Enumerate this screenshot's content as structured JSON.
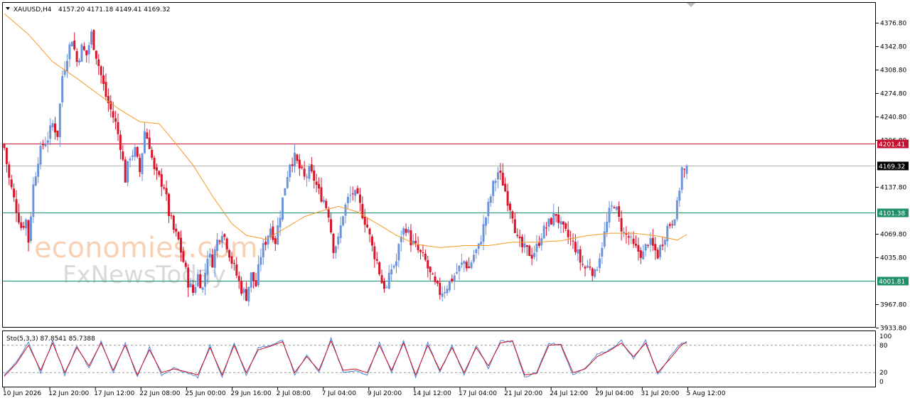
{
  "header": {
    "symbol": "XAUUSD,H4",
    "ohlc": "4157.20 4171.18 4149.41 4169.32"
  },
  "watermark": {
    "line1": "economies.com",
    "line2": "FxNewsToday"
  },
  "colors": {
    "bull": "#6c94dc",
    "bear": "#d9142b",
    "ma": "#f59a23",
    "resistance": "#c8102e",
    "support": "#1f8f6a",
    "current": "#b5b5b5",
    "stoch_k": "#4f86d6",
    "stoch_d": "#d0101e"
  },
  "chart_data": [
    {
      "type": "candlestick",
      "symbol": "XAUUSD",
      "timeframe": "H4",
      "y_ticks": [
        "4376.80",
        "4342.80",
        "4308.80",
        "4274.80",
        "4240.80",
        "4206.80",
        "4137.80",
        "4069.80",
        "4035.80",
        "3967.80",
        "3933.80"
      ],
      "ylim": [
        3933.8,
        4393.0
      ],
      "x_ticks": [
        "10 Jun 2026",
        "12 Jun 20:00",
        "17 Jun 12:00",
        "22 Jun 08:00",
        "25 Jun 00:00",
        "29 Jun 16:00",
        "2 Jul 08:00",
        "7 Jul 04:00",
        "9 Jul 20:00",
        "14 Jul 12:00",
        "17 Jul 04:00",
        "21 Jul 20:00",
        "24 Jul 12:00",
        "29 Jul 04:00",
        "31 Jul 20:00",
        "5 Aug 12:00"
      ],
      "levels": [
        {
          "label": "4201.41",
          "value": 4201.41,
          "kind": "resistance"
        },
        {
          "label": "4169.32",
          "value": 4169.32,
          "kind": "current"
        },
        {
          "label": "4101.38",
          "value": 4101.38,
          "kind": "support"
        },
        {
          "label": "4001.81",
          "value": 4001.81,
          "kind": "support"
        }
      ],
      "close_anchors": [
        [
          0,
          4195
        ],
        [
          2,
          4150
        ],
        [
          4,
          4120
        ],
        [
          7,
          4080
        ],
        [
          9,
          4090
        ],
        [
          10,
          4060
        ],
        [
          12,
          4140
        ],
        [
          14,
          4180
        ],
        [
          16,
          4200
        ],
        [
          18,
          4210
        ],
        [
          20,
          4230
        ],
        [
          22,
          4215
        ],
        [
          24,
          4300
        ],
        [
          26,
          4330
        ],
        [
          28,
          4355
        ],
        [
          30,
          4320
        ],
        [
          32,
          4340
        ],
        [
          34,
          4330
        ],
        [
          36,
          4360
        ],
        [
          38,
          4330
        ],
        [
          40,
          4300
        ],
        [
          42,
          4270
        ],
        [
          44,
          4250
        ],
        [
          46,
          4230
        ],
        [
          48,
          4200
        ],
        [
          50,
          4150
        ],
        [
          52,
          4185
        ],
        [
          54,
          4190
        ],
        [
          56,
          4160
        ],
        [
          58,
          4220
        ],
        [
          60,
          4200
        ],
        [
          62,
          4160
        ],
        [
          64,
          4150
        ],
        [
          66,
          4140
        ],
        [
          68,
          4100
        ],
        [
          70,
          4075
        ],
        [
          72,
          4060
        ],
        [
          74,
          4030
        ],
        [
          76,
          4000
        ],
        [
          78,
          3985
        ],
        [
          80,
          4010
        ],
        [
          82,
          3990
        ],
        [
          84,
          4040
        ],
        [
          86,
          4030
        ],
        [
          88,
          4060
        ],
        [
          90,
          4075
        ],
        [
          92,
          4055
        ],
        [
          94,
          4030
        ],
        [
          96,
          4010
        ],
        [
          98,
          3990
        ],
        [
          100,
          3980
        ],
        [
          102,
          4010
        ],
        [
          104,
          3995
        ],
        [
          106,
          4040
        ],
        [
          108,
          4060
        ],
        [
          110,
          4080
        ],
        [
          112,
          4060
        ],
        [
          114,
          4100
        ],
        [
          116,
          4140
        ],
        [
          118,
          4175
        ],
        [
          120,
          4180
        ],
        [
          122,
          4165
        ],
        [
          124,
          4150
        ],
        [
          126,
          4160
        ],
        [
          128,
          4150
        ],
        [
          130,
          4130
        ],
        [
          132,
          4120
        ],
        [
          134,
          4100
        ],
        [
          136,
          4050
        ],
        [
          138,
          4060
        ],
        [
          140,
          4100
        ],
        [
          142,
          4120
        ],
        [
          144,
          4130
        ],
        [
          146,
          4120
        ],
        [
          148,
          4100
        ],
        [
          150,
          4080
        ],
        [
          152,
          4050
        ],
        [
          154,
          4030
        ],
        [
          156,
          4000
        ],
        [
          158,
          3990
        ],
        [
          160,
          4020
        ],
        [
          162,
          4030
        ],
        [
          164,
          4070
        ],
        [
          166,
          4080
        ],
        [
          168,
          4060
        ],
        [
          170,
          4050
        ],
        [
          172,
          4040
        ],
        [
          174,
          4030
        ],
        [
          176,
          4010
        ],
        [
          178,
          3995
        ],
        [
          180,
          3985
        ],
        [
          182,
          3990
        ],
        [
          184,
          4000
        ],
        [
          186,
          4010
        ],
        [
          188,
          4020
        ],
        [
          190,
          4030
        ],
        [
          192,
          4020
        ],
        [
          194,
          4040
        ],
        [
          196,
          4050
        ],
        [
          198,
          4080
        ],
        [
          200,
          4110
        ],
        [
          202,
          4140
        ],
        [
          204,
          4160
        ],
        [
          206,
          4145
        ],
        [
          208,
          4120
        ],
        [
          210,
          4100
        ],
        [
          212,
          4060
        ],
        [
          214,
          4050
        ],
        [
          216,
          4045
        ],
        [
          218,
          4040
        ],
        [
          220,
          4050
        ],
        [
          222,
          4070
        ],
        [
          224,
          4080
        ],
        [
          226,
          4090
        ],
        [
          228,
          4100
        ],
        [
          230,
          4080
        ],
        [
          232,
          4070
        ],
        [
          234,
          4060
        ],
        [
          236,
          4050
        ],
        [
          238,
          4030
        ],
        [
          240,
          4020
        ],
        [
          242,
          4025
        ],
        [
          244,
          4010
        ],
        [
          246,
          4040
        ],
        [
          248,
          4070
        ],
        [
          250,
          4100
        ],
        [
          252,
          4115
        ],
        [
          254,
          4090
        ],
        [
          256,
          4070
        ],
        [
          258,
          4065
        ],
        [
          260,
          4050
        ],
        [
          262,
          4045
        ],
        [
          264,
          4040
        ],
        [
          266,
          4060
        ],
        [
          268,
          4050
        ],
        [
          270,
          4040
        ],
        [
          272,
          4060
        ],
        [
          274,
          4080
        ],
        [
          276,
          4090
        ],
        [
          278,
          4110
        ],
        [
          280,
          4165
        ],
        [
          281,
          4160
        ],
        [
          282,
          4169.32
        ]
      ],
      "ma_values": [
        [
          0,
          4390
        ],
        [
          10,
          4360
        ],
        [
          20,
          4320
        ],
        [
          30,
          4296
        ],
        [
          40,
          4270
        ],
        [
          48,
          4250
        ],
        [
          56,
          4233
        ],
        [
          64,
          4230
        ],
        [
          70,
          4205
        ],
        [
          78,
          4170
        ],
        [
          86,
          4125
        ],
        [
          94,
          4085
        ],
        [
          100,
          4068
        ],
        [
          108,
          4062
        ],
        [
          116,
          4078
        ],
        [
          124,
          4095
        ],
        [
          130,
          4102
        ],
        [
          138,
          4110
        ],
        [
          146,
          4102
        ],
        [
          154,
          4085
        ],
        [
          162,
          4068
        ],
        [
          170,
          4055
        ],
        [
          180,
          4050
        ],
        [
          190,
          4053
        ],
        [
          200,
          4053
        ],
        [
          210,
          4058
        ],
        [
          220,
          4058
        ],
        [
          230,
          4060
        ],
        [
          240,
          4067
        ],
        [
          250,
          4071
        ],
        [
          260,
          4071
        ],
        [
          270,
          4067
        ],
        [
          278,
          4061
        ],
        [
          282,
          4069
        ]
      ]
    },
    {
      "type": "line",
      "indicator": "Stochastic Oscillator",
      "label": "Sto(5,3,3) 87.8541 85.7388",
      "ylim": [
        0,
        100
      ],
      "y_ticks": [
        "100",
        "80",
        "20",
        "0"
      ],
      "levels": [
        80,
        20
      ],
      "series": [
        {
          "name": "%K",
          "values": [
            [
              0,
              15
            ],
            [
              5,
              45
            ],
            [
              10,
              85
            ],
            [
              15,
              20
            ],
            [
              20,
              90
            ],
            [
              25,
              15
            ],
            [
              30,
              80
            ],
            [
              35,
              30
            ],
            [
              40,
              88
            ],
            [
              45,
              20
            ],
            [
              50,
              85
            ],
            [
              55,
              10
            ],
            [
              60,
              75
            ],
            [
              65,
              15
            ],
            [
              70,
              30
            ],
            [
              75,
              20
            ],
            [
              80,
              10
            ],
            [
              85,
              80
            ],
            [
              90,
              10
            ],
            [
              95,
              85
            ],
            [
              100,
              15
            ],
            [
              105,
              75
            ],
            [
              110,
              80
            ],
            [
              115,
              90
            ],
            [
              120,
              15
            ],
            [
              125,
              60
            ],
            [
              130,
              20
            ],
            [
              135,
              95
            ],
            [
              140,
              20
            ],
            [
              145,
              25
            ],
            [
              150,
              15
            ],
            [
              155,
              85
            ],
            [
              160,
              20
            ],
            [
              165,
              90
            ],
            [
              170,
              10
            ],
            [
              175,
              85
            ],
            [
              180,
              20
            ],
            [
              185,
              80
            ],
            [
              190,
              15
            ],
            [
              195,
              80
            ],
            [
              200,
              30
            ],
            [
              205,
              90
            ],
            [
              210,
              88
            ],
            [
              215,
              10
            ],
            [
              220,
              20
            ],
            [
              225,
              85
            ],
            [
              230,
              80
            ],
            [
              235,
              15
            ],
            [
              240,
              30
            ],
            [
              245,
              60
            ],
            [
              250,
              70
            ],
            [
              255,
              90
            ],
            [
              260,
              50
            ],
            [
              265,
              90
            ],
            [
              270,
              15
            ],
            [
              275,
              55
            ],
            [
              280,
              85
            ],
            [
              282,
              87.85
            ]
          ]
        },
        {
          "name": "%D",
          "values": [
            [
              0,
              12
            ],
            [
              5,
              40
            ],
            [
              10,
              80
            ],
            [
              15,
              25
            ],
            [
              20,
              85
            ],
            [
              25,
              20
            ],
            [
              30,
              75
            ],
            [
              35,
              35
            ],
            [
              40,
              85
            ],
            [
              45,
              25
            ],
            [
              50,
              80
            ],
            [
              55,
              15
            ],
            [
              60,
              70
            ],
            [
              65,
              20
            ],
            [
              70,
              28
            ],
            [
              75,
              22
            ],
            [
              80,
              15
            ],
            [
              85,
              75
            ],
            [
              90,
              15
            ],
            [
              95,
              80
            ],
            [
              100,
              20
            ],
            [
              105,
              70
            ],
            [
              110,
              78
            ],
            [
              115,
              88
            ],
            [
              120,
              20
            ],
            [
              125,
              55
            ],
            [
              130,
              25
            ],
            [
              135,
              90
            ],
            [
              140,
              25
            ],
            [
              145,
              28
            ],
            [
              150,
              20
            ],
            [
              155,
              80
            ],
            [
              160,
              25
            ],
            [
              165,
              85
            ],
            [
              170,
              15
            ],
            [
              175,
              80
            ],
            [
              180,
              25
            ],
            [
              185,
              75
            ],
            [
              190,
              20
            ],
            [
              195,
              75
            ],
            [
              200,
              35
            ],
            [
              205,
              85
            ],
            [
              210,
              90
            ],
            [
              215,
              15
            ],
            [
              220,
              18
            ],
            [
              225,
              80
            ],
            [
              230,
              82
            ],
            [
              235,
              20
            ],
            [
              240,
              28
            ],
            [
              245,
              55
            ],
            [
              250,
              68
            ],
            [
              255,
              85
            ],
            [
              260,
              55
            ],
            [
              265,
              85
            ],
            [
              270,
              20
            ],
            [
              275,
              50
            ],
            [
              280,
              82
            ],
            [
              282,
              85.74
            ]
          ]
        }
      ]
    }
  ]
}
